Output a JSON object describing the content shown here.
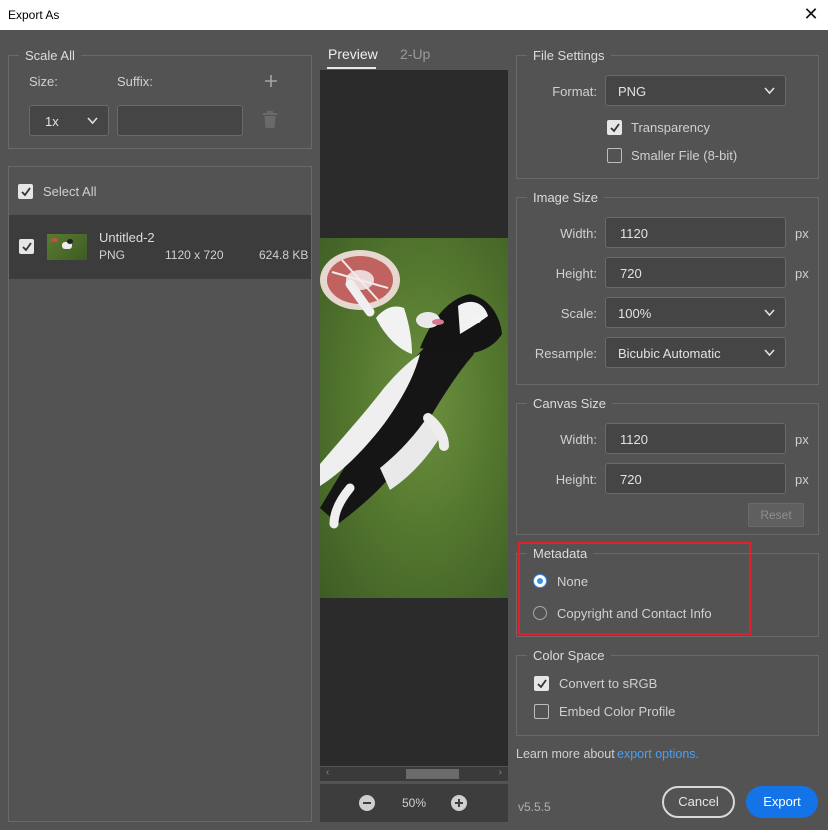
{
  "window": {
    "title": "Export As"
  },
  "scale_all": {
    "legend": "Scale All",
    "size_label": "Size:",
    "suffix_label": "Suffix:",
    "size_value": "1x",
    "suffix_value": ""
  },
  "files": {
    "select_all_label": "Select All",
    "items": [
      {
        "name": "Untitled-2",
        "format": "PNG",
        "dimensions": "1120 x 720",
        "size": "624.8 KB"
      }
    ]
  },
  "preview": {
    "tabs": [
      "Preview",
      "2-Up"
    ],
    "zoom": "50%"
  },
  "file_settings": {
    "legend": "File Settings",
    "format_label": "Format:",
    "format_value": "PNG",
    "transparency_label": "Transparency",
    "smaller_file_label": "Smaller File (8-bit)"
  },
  "image_size": {
    "legend": "Image Size",
    "width_label": "Width:",
    "width_value": "1120",
    "height_label": "Height:",
    "height_value": "720",
    "scale_label": "Scale:",
    "scale_value": "100%",
    "resample_label": "Resample:",
    "resample_value": "Bicubic Automatic",
    "unit": "px"
  },
  "canvas_size": {
    "legend": "Canvas Size",
    "width_label": "Width:",
    "width_value": "1120",
    "height_label": "Height:",
    "height_value": "720",
    "unit": "px",
    "reset_label": "Reset"
  },
  "metadata": {
    "legend": "Metadata",
    "options": [
      "None",
      "Copyright and Contact Info"
    ],
    "selected": "None"
  },
  "color_space": {
    "legend": "Color Space",
    "convert_label": "Convert to sRGB",
    "embed_label": "Embed Color Profile"
  },
  "footer": {
    "learn_more": "Learn more about",
    "link": "export options.",
    "version": "v5.5.5",
    "cancel_label": "Cancel",
    "export_label": "Export"
  },
  "colors": {
    "accent": "#1473e6",
    "highlight": "#e0202a",
    "link": "#4b9ff2"
  }
}
